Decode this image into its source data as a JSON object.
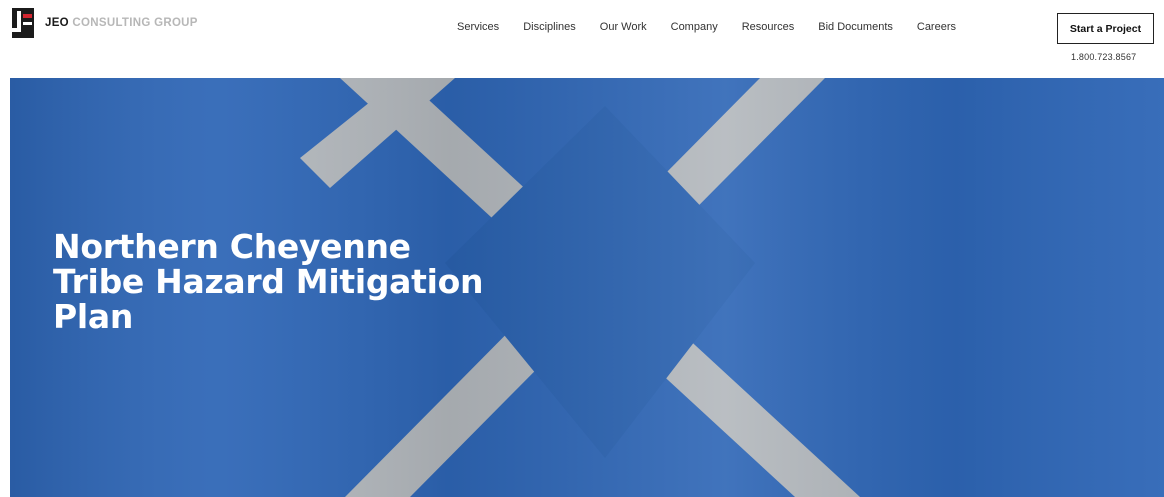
{
  "colors": {
    "hero_blue": "#2e66b6",
    "stripe_gray": "#b3b8bd",
    "logo_red": "#d22630"
  },
  "logo": {
    "brand": "JEO",
    "rest": "CONSULTING GROUP"
  },
  "nav": {
    "items": [
      {
        "label": "Services"
      },
      {
        "label": "Disciplines"
      },
      {
        "label": "Our Work"
      },
      {
        "label": "Company"
      },
      {
        "label": "Resources"
      },
      {
        "label": "Bid Documents"
      },
      {
        "label": "Careers"
      }
    ],
    "cta_label": "Start a Project",
    "phone": "1.800.723.8567"
  },
  "hero": {
    "title_lines": [
      "Northern Cheyenne",
      "Tribe Hazard Mitigation",
      "Plan"
    ]
  }
}
